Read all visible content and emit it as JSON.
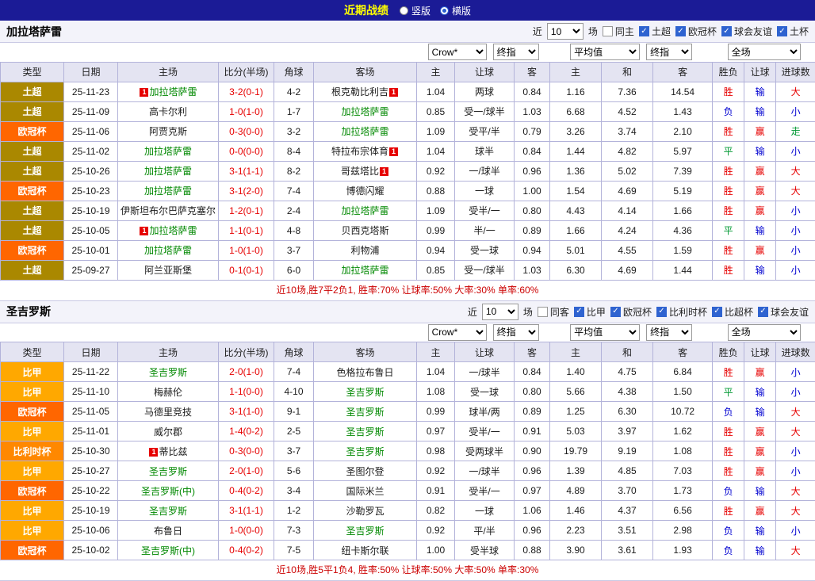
{
  "topbar": {
    "title": "近期战绩",
    "options": [
      {
        "name": "vertical",
        "label": "竖版",
        "selected": false
      },
      {
        "name": "horizontal",
        "label": "横版",
        "selected": true
      }
    ]
  },
  "colors": {
    "win": "#e60000",
    "lose": "#0000d0",
    "draw": "#009933",
    "big": "#e60000",
    "small": "#0000d0",
    "push": "#009933",
    "focal_team": "#008800",
    "other_team": "#1c1c1c",
    "score": "#e60000",
    "topbar_bg": "#1b1b96",
    "title_color": "#ffff00",
    "leagues": {
      "土超": "#aa8800",
      "欧冠杯": "#ff6600",
      "比甲": "#ffa800",
      "比利时杯": "#ff8800"
    }
  },
  "headers": [
    "类型",
    "日期",
    "主场",
    "比分(半场)",
    "角球",
    "客场",
    "主",
    "让球",
    "客",
    "主",
    "和",
    "客",
    "胜负",
    "让球",
    "进球数"
  ],
  "sections": [
    {
      "team": "加拉塔萨雷",
      "filter": {
        "prefix": "近",
        "count": "10",
        "suffix": "场",
        "same": {
          "label": "同主",
          "checked": false
        },
        "comps": [
          {
            "label": "土超",
            "checked": true
          },
          {
            "label": "欧冠杯",
            "checked": true
          },
          {
            "label": "球会友谊",
            "checked": true
          },
          {
            "label": "土杯",
            "checked": true
          }
        ]
      },
      "selects": {
        "company": "Crow*",
        "company_time": "终指",
        "avg": "平均值",
        "avg_time": "终指",
        "scope": "全场"
      },
      "rows": [
        {
          "league": "土超",
          "date": "25-11-23",
          "home": {
            "name": "加拉塔萨雷",
            "focal": true,
            "badge": "pre"
          },
          "score": "3-2(0-1)",
          "corners": "4-2",
          "away": {
            "name": "根克勒比利吉",
            "focal": false,
            "badge": "post"
          },
          "odds": [
            "1.04",
            "两球",
            "0.84"
          ],
          "avg": [
            "1.16",
            "7.36",
            "14.54"
          ],
          "results": [
            {
              "t": "胜",
              "c": "win"
            },
            {
              "t": "输",
              "c": "lose"
            },
            {
              "t": "大",
              "c": "big"
            }
          ]
        },
        {
          "league": "土超",
          "date": "25-11-09",
          "home": {
            "name": "高卡尔利",
            "focal": false
          },
          "score": "1-0(1-0)",
          "corners": "1-7",
          "away": {
            "name": "加拉塔萨雷",
            "focal": true
          },
          "odds": [
            "0.85",
            "受一/球半",
            "1.03"
          ],
          "avg": [
            "6.68",
            "4.52",
            "1.43"
          ],
          "results": [
            {
              "t": "负",
              "c": "lose"
            },
            {
              "t": "输",
              "c": "lose"
            },
            {
              "t": "小",
              "c": "small"
            }
          ]
        },
        {
          "league": "欧冠杯",
          "date": "25-11-06",
          "home": {
            "name": "阿贾克斯",
            "focal": false
          },
          "score": "0-3(0-0)",
          "corners": "3-2",
          "away": {
            "name": "加拉塔萨雷",
            "focal": true
          },
          "odds": [
            "1.09",
            "受平/半",
            "0.79"
          ],
          "avg": [
            "3.26",
            "3.74",
            "2.10"
          ],
          "results": [
            {
              "t": "胜",
              "c": "win"
            },
            {
              "t": "赢",
              "c": "win"
            },
            {
              "t": "走",
              "c": "push"
            }
          ]
        },
        {
          "league": "土超",
          "date": "25-11-02",
          "home": {
            "name": "加拉塔萨雷",
            "focal": true
          },
          "score": "0-0(0-0)",
          "corners": "8-4",
          "away": {
            "name": "特拉布宗体育",
            "focal": false,
            "badge": "post"
          },
          "odds": [
            "1.04",
            "球半",
            "0.84"
          ],
          "avg": [
            "1.44",
            "4.82",
            "5.97"
          ],
          "results": [
            {
              "t": "平",
              "c": "draw"
            },
            {
              "t": "输",
              "c": "lose"
            },
            {
              "t": "小",
              "c": "small"
            }
          ]
        },
        {
          "league": "土超",
          "date": "25-10-26",
          "home": {
            "name": "加拉塔萨雷",
            "focal": true
          },
          "score": "3-1(1-1)",
          "corners": "8-2",
          "away": {
            "name": "哥兹塔比",
            "focal": false,
            "badge": "post"
          },
          "odds": [
            "0.92",
            "一/球半",
            "0.96"
          ],
          "avg": [
            "1.36",
            "5.02",
            "7.39"
          ],
          "results": [
            {
              "t": "胜",
              "c": "win"
            },
            {
              "t": "赢",
              "c": "win"
            },
            {
              "t": "大",
              "c": "big"
            }
          ]
        },
        {
          "league": "欧冠杯",
          "date": "25-10-23",
          "home": {
            "name": "加拉塔萨雷",
            "focal": true
          },
          "score": "3-1(2-0)",
          "corners": "7-4",
          "away": {
            "name": "博德闪耀",
            "focal": false
          },
          "odds": [
            "0.88",
            "一球",
            "1.00"
          ],
          "avg": [
            "1.54",
            "4.69",
            "5.19"
          ],
          "results": [
            {
              "t": "胜",
              "c": "win"
            },
            {
              "t": "赢",
              "c": "win"
            },
            {
              "t": "大",
              "c": "big"
            }
          ]
        },
        {
          "league": "土超",
          "date": "25-10-19",
          "home": {
            "name": "伊斯坦布尔巴萨克塞尔",
            "focal": false
          },
          "score": "1-2(0-1)",
          "corners": "2-4",
          "away": {
            "name": "加拉塔萨雷",
            "focal": true
          },
          "odds": [
            "1.09",
            "受半/一",
            "0.80"
          ],
          "avg": [
            "4.43",
            "4.14",
            "1.66"
          ],
          "results": [
            {
              "t": "胜",
              "c": "win"
            },
            {
              "t": "赢",
              "c": "win"
            },
            {
              "t": "小",
              "c": "small"
            }
          ]
        },
        {
          "league": "土超",
          "date": "25-10-05",
          "home": {
            "name": "加拉塔萨雷",
            "focal": true,
            "badge": "pre"
          },
          "score": "1-1(0-1)",
          "corners": "4-8",
          "away": {
            "name": "贝西克塔斯",
            "focal": false
          },
          "odds": [
            "0.99",
            "半/一",
            "0.89"
          ],
          "avg": [
            "1.66",
            "4.24",
            "4.36"
          ],
          "results": [
            {
              "t": "平",
              "c": "draw"
            },
            {
              "t": "输",
              "c": "lose"
            },
            {
              "t": "小",
              "c": "small"
            }
          ]
        },
        {
          "league": "欧冠杯",
          "date": "25-10-01",
          "home": {
            "name": "加拉塔萨雷",
            "focal": true
          },
          "score": "1-0(1-0)",
          "corners": "3-7",
          "away": {
            "name": "利物浦",
            "focal": false
          },
          "odds": [
            "0.94",
            "受一球",
            "0.94"
          ],
          "avg": [
            "5.01",
            "4.55",
            "1.59"
          ],
          "results": [
            {
              "t": "胜",
              "c": "win"
            },
            {
              "t": "赢",
              "c": "win"
            },
            {
              "t": "小",
              "c": "small"
            }
          ]
        },
        {
          "league": "土超",
          "date": "25-09-27",
          "home": {
            "name": "阿兰亚斯堡",
            "focal": false
          },
          "score": "0-1(0-1)",
          "corners": "6-0",
          "away": {
            "name": "加拉塔萨雷",
            "focal": true
          },
          "odds": [
            "0.85",
            "受一/球半",
            "1.03"
          ],
          "avg": [
            "6.30",
            "4.69",
            "1.44"
          ],
          "results": [
            {
              "t": "胜",
              "c": "win"
            },
            {
              "t": "输",
              "c": "lose"
            },
            {
              "t": "小",
              "c": "small"
            }
          ]
        }
      ],
      "summary": "近10场,胜7平2负1, 胜率:70% 让球率:50% 大率:30% 单率:60%"
    },
    {
      "team": "圣吉罗斯",
      "filter": {
        "prefix": "近",
        "count": "10",
        "suffix": "场",
        "same": {
          "label": "同客",
          "checked": false
        },
        "comps": [
          {
            "label": "比甲",
            "checked": true
          },
          {
            "label": "欧冠杯",
            "checked": true
          },
          {
            "label": "比利时杯",
            "checked": true
          },
          {
            "label": "比超杯",
            "checked": true
          },
          {
            "label": "球会友谊",
            "checked": true
          }
        ]
      },
      "selects": {
        "company": "Crow*",
        "company_time": "终指",
        "avg": "平均值",
        "avg_time": "终指",
        "scope": "全场"
      },
      "rows": [
        {
          "league": "比甲",
          "date": "25-11-22",
          "home": {
            "name": "圣吉罗斯",
            "focal": true
          },
          "score": "2-0(1-0)",
          "corners": "7-4",
          "away": {
            "name": "色格拉布鲁日",
            "focal": false
          },
          "odds": [
            "1.04",
            "一/球半",
            "0.84"
          ],
          "avg": [
            "1.40",
            "4.75",
            "6.84"
          ],
          "results": [
            {
              "t": "胜",
              "c": "win"
            },
            {
              "t": "赢",
              "c": "win"
            },
            {
              "t": "小",
              "c": "small"
            }
          ]
        },
        {
          "league": "比甲",
          "date": "25-11-10",
          "home": {
            "name": "梅赫伦",
            "focal": false
          },
          "score": "1-1(0-0)",
          "corners": "4-10",
          "away": {
            "name": "圣吉罗斯",
            "focal": true
          },
          "odds": [
            "1.08",
            "受一球",
            "0.80"
          ],
          "avg": [
            "5.66",
            "4.38",
            "1.50"
          ],
          "results": [
            {
              "t": "平",
              "c": "draw"
            },
            {
              "t": "输",
              "c": "lose"
            },
            {
              "t": "小",
              "c": "small"
            }
          ]
        },
        {
          "league": "欧冠杯",
          "date": "25-11-05",
          "home": {
            "name": "马德里竞技",
            "focal": false
          },
          "score": "3-1(1-0)",
          "corners": "9-1",
          "away": {
            "name": "圣吉罗斯",
            "focal": true
          },
          "odds": [
            "0.99",
            "球半/两",
            "0.89"
          ],
          "avg": [
            "1.25",
            "6.30",
            "10.72"
          ],
          "results": [
            {
              "t": "负",
              "c": "lose"
            },
            {
              "t": "输",
              "c": "lose"
            },
            {
              "t": "大",
              "c": "big"
            }
          ]
        },
        {
          "league": "比甲",
          "date": "25-11-01",
          "home": {
            "name": "威尔郡",
            "focal": false
          },
          "score": "1-4(0-2)",
          "corners": "2-5",
          "away": {
            "name": "圣吉罗斯",
            "focal": true
          },
          "odds": [
            "0.97",
            "受半/一",
            "0.91"
          ],
          "avg": [
            "5.03",
            "3.97",
            "1.62"
          ],
          "results": [
            {
              "t": "胜",
              "c": "win"
            },
            {
              "t": "赢",
              "c": "win"
            },
            {
              "t": "大",
              "c": "big"
            }
          ]
        },
        {
          "league": "比利时杯",
          "date": "25-10-30",
          "home": {
            "name": "蒂比兹",
            "focal": false,
            "badge": "pre"
          },
          "score": "0-3(0-0)",
          "corners": "3-7",
          "away": {
            "name": "圣吉罗斯",
            "focal": true
          },
          "odds": [
            "0.98",
            "受两球半",
            "0.90"
          ],
          "avg": [
            "19.79",
            "9.19",
            "1.08"
          ],
          "results": [
            {
              "t": "胜",
              "c": "win"
            },
            {
              "t": "赢",
              "c": "win"
            },
            {
              "t": "小",
              "c": "small"
            }
          ]
        },
        {
          "league": "比甲",
          "date": "25-10-27",
          "home": {
            "name": "圣吉罗斯",
            "focal": true
          },
          "score": "2-0(1-0)",
          "corners": "5-6",
          "away": {
            "name": "圣图尔登",
            "focal": false
          },
          "odds": [
            "0.92",
            "一/球半",
            "0.96"
          ],
          "avg": [
            "1.39",
            "4.85",
            "7.03"
          ],
          "results": [
            {
              "t": "胜",
              "c": "win"
            },
            {
              "t": "赢",
              "c": "win"
            },
            {
              "t": "小",
              "c": "small"
            }
          ]
        },
        {
          "league": "欧冠杯",
          "date": "25-10-22",
          "home": {
            "name": "圣吉罗斯(中)",
            "focal": true
          },
          "score": "0-4(0-2)",
          "corners": "3-4",
          "away": {
            "name": "国际米兰",
            "focal": false
          },
          "odds": [
            "0.91",
            "受半/一",
            "0.97"
          ],
          "avg": [
            "4.89",
            "3.70",
            "1.73"
          ],
          "results": [
            {
              "t": "负",
              "c": "lose"
            },
            {
              "t": "输",
              "c": "lose"
            },
            {
              "t": "大",
              "c": "big"
            }
          ]
        },
        {
          "league": "比甲",
          "date": "25-10-19",
          "home": {
            "name": "圣吉罗斯",
            "focal": true
          },
          "score": "3-1(1-1)",
          "corners": "1-2",
          "away": {
            "name": "沙勒罗瓦",
            "focal": false
          },
          "odds": [
            "0.82",
            "一球",
            "1.06"
          ],
          "avg": [
            "1.46",
            "4.37",
            "6.56"
          ],
          "results": [
            {
              "t": "胜",
              "c": "win"
            },
            {
              "t": "赢",
              "c": "win"
            },
            {
              "t": "大",
              "c": "big"
            }
          ]
        },
        {
          "league": "比甲",
          "date": "25-10-06",
          "home": {
            "name": "布鲁日",
            "focal": false
          },
          "score": "1-0(0-0)",
          "corners": "7-3",
          "away": {
            "name": "圣吉罗斯",
            "focal": true
          },
          "odds": [
            "0.92",
            "平/半",
            "0.96"
          ],
          "avg": [
            "2.23",
            "3.51",
            "2.98"
          ],
          "results": [
            {
              "t": "负",
              "c": "lose"
            },
            {
              "t": "输",
              "c": "lose"
            },
            {
              "t": "小",
              "c": "small"
            }
          ]
        },
        {
          "league": "欧冠杯",
          "date": "25-10-02",
          "home": {
            "name": "圣吉罗斯(中)",
            "focal": true
          },
          "score": "0-4(0-2)",
          "corners": "7-5",
          "away": {
            "name": "纽卡斯尔联",
            "focal": false
          },
          "odds": [
            "1.00",
            "受半球",
            "0.88"
          ],
          "avg": [
            "3.90",
            "3.61",
            "1.93"
          ],
          "results": [
            {
              "t": "负",
              "c": "lose"
            },
            {
              "t": "输",
              "c": "lose"
            },
            {
              "t": "大",
              "c": "big"
            }
          ]
        }
      ],
      "summary": "近10场,胜5平1负4, 胜率:50% 让球率:50% 大率:50% 单率:30%"
    }
  ]
}
